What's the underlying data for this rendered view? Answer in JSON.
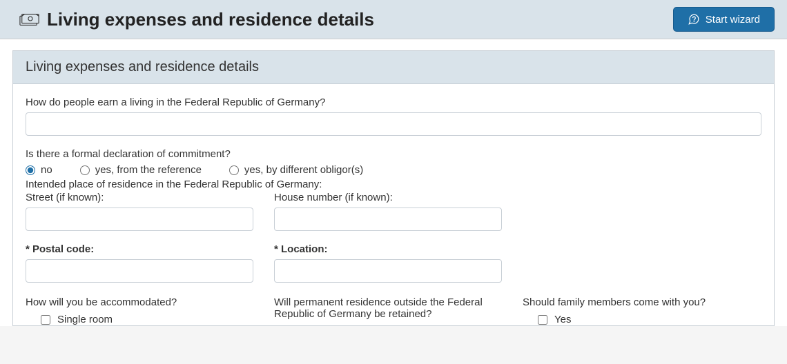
{
  "header": {
    "title": "Living expenses and residence details",
    "wizard_button": "Start wizard"
  },
  "panel": {
    "title": "Living expenses and residence details"
  },
  "form": {
    "q_earn_living": "How do people earn a living in the Federal Republic of Germany?",
    "earn_living_value": "",
    "q_commitment": "Is there a formal declaration of commitment?",
    "commitment_options": {
      "no": "no",
      "yes_ref": "yes, from the reference",
      "yes_obl": "yes, by different obligor(s)"
    },
    "intended_place": "Intended place of residence in the Federal Republic of Germany:",
    "street_label": "Street (if known):",
    "street_value": "",
    "house_label": "House number (if known):",
    "house_value": "",
    "postal_label": "* Postal code:",
    "postal_value": "",
    "location_label": "* Location:",
    "location_value": "",
    "q_accommodated": "How will you be accommodated?",
    "accommodated_options": {
      "single": "Single room"
    },
    "q_permanent": "Will permanent residence outside the Federal Republic of Germany be retained?",
    "q_family": "Should family members come with you?",
    "family_options": {
      "yes": "Yes"
    }
  }
}
